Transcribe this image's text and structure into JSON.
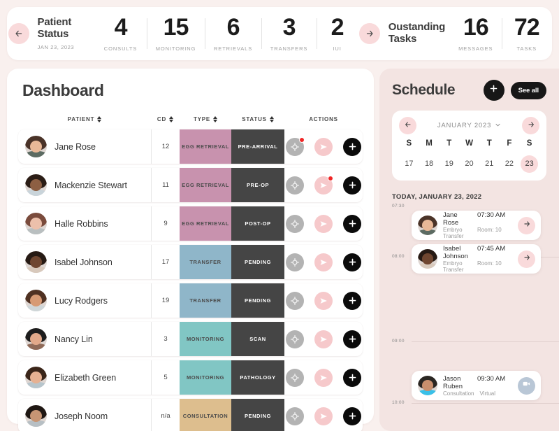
{
  "topbar": {
    "back_icon": "arrow-left-icon",
    "forward_icon": "arrow-right-icon",
    "left_title": "Patient\nStatus",
    "left_title_l1": "Patient",
    "left_title_l2": "Status",
    "left_date": "JAN 23, 2023",
    "right_title_l1": "Oustanding",
    "right_title_l2": "Tasks",
    "left_stats": [
      {
        "num": "4",
        "label": "CONSULTS"
      },
      {
        "num": "15",
        "label": "MONITORING"
      },
      {
        "num": "6",
        "label": "RETRIEVALS"
      },
      {
        "num": "3",
        "label": "TRANSFERS"
      },
      {
        "num": "2",
        "label": "IUI"
      }
    ],
    "right_stats": [
      {
        "num": "16",
        "label": "MESSAGES"
      },
      {
        "num": "72",
        "label": "TASKS"
      }
    ]
  },
  "dashboard": {
    "title": "Dashboard",
    "columns": [
      {
        "label": "PATIENT",
        "sortable": true
      },
      {
        "label": "CD",
        "sortable": true
      },
      {
        "label": "TYPE",
        "sortable": true
      },
      {
        "label": "STATUS",
        "sortable": true
      },
      {
        "label": "ACTIONS",
        "sortable": false
      }
    ],
    "action_icons": [
      "target-icon",
      "send-icon",
      "plus-icon"
    ],
    "rows": [
      {
        "name": "Jane Rose",
        "cd": "12",
        "type": "EGG RETRIEVAL",
        "type_color": "#c892ae",
        "status": "PRE-ARRIVAL",
        "badge_target": true,
        "badge_send": false,
        "avatar": {
          "hair": "#4a3328",
          "skin": "#e8b897",
          "body": "#5c6b62"
        }
      },
      {
        "name": "Mackenzie Stewart",
        "cd": "11",
        "type": "EGG RETRIEVAL",
        "type_color": "#c892ae",
        "status": "PRE-OP",
        "badge_target": false,
        "badge_send": true,
        "avatar": {
          "hair": "#2b1d16",
          "skin": "#8d5f43",
          "body": "#c9d4da"
        }
      },
      {
        "name": "Halle Robbins",
        "cd": "9",
        "type": "EGG RETRIEVAL",
        "type_color": "#c892ae",
        "status": "POST-OP",
        "badge_target": false,
        "badge_send": false,
        "avatar": {
          "hair": "#7a4b3c",
          "skin": "#ecc0ab",
          "body": "#b9bfc0"
        }
      },
      {
        "name": "Isabel Johnson",
        "cd": "17",
        "type": "TRANSFER",
        "type_color": "#8fb6c9",
        "status": "PENDING",
        "badge_target": false,
        "badge_send": false,
        "avatar": {
          "hair": "#261a14",
          "skin": "#6f4630",
          "body": "#d8c9bc"
        }
      },
      {
        "name": "Lucy Rodgers",
        "cd": "19",
        "type": "TRANSFER",
        "type_color": "#8fb6c9",
        "status": "PENDING",
        "badge_target": false,
        "badge_send": false,
        "avatar": {
          "hair": "#4f3122",
          "skin": "#d79a74",
          "body": "#cfd6d8"
        }
      },
      {
        "name": "Nancy Lin",
        "cd": "3",
        "type": "MONITORING",
        "type_color": "#81c6c4",
        "status": "SCAN",
        "badge_target": false,
        "badge_send": false,
        "avatar": {
          "hair": "#1d1d1d",
          "skin": "#e2a98a",
          "body": "#8f6a58"
        }
      },
      {
        "name": "Elizabeth Green",
        "cd": "5",
        "type": "MONITORING",
        "type_color": "#81c6c4",
        "status": "PATHOLOGY",
        "badge_target": false,
        "badge_send": false,
        "avatar": {
          "hair": "#3a2519",
          "skin": "#e6b192",
          "body": "#b7c5cc"
        }
      },
      {
        "name": "Joseph Noom",
        "cd": "n/a",
        "type": "CONSULTATION",
        "type_color": "#ddbe8e",
        "status": "PENDING",
        "badge_target": false,
        "badge_send": false,
        "avatar": {
          "hair": "#1f1713",
          "skin": "#c79574",
          "body": "#b7bfc4"
        }
      }
    ]
  },
  "schedule": {
    "title": "Schedule",
    "add_icon": "plus-icon",
    "see_all_label": "See all",
    "calendar": {
      "prev_icon": "arrow-left-icon",
      "next_icon": "arrow-right-icon",
      "month_label": "JANUARY 2023",
      "chevron_icon": "chevron-down-icon",
      "dow": [
        "S",
        "M",
        "T",
        "W",
        "T",
        "F",
        "S"
      ],
      "days": [
        "17",
        "18",
        "19",
        "20",
        "21",
        "22",
        "23"
      ],
      "selected_day": "23"
    },
    "today_label": "TODAY, JANUARY 23, 2022",
    "time_marks": [
      "07:30",
      "08:00",
      "09:00",
      "10:00"
    ],
    "appointments": [
      {
        "name": "Jane Rose",
        "subtitle": "Embryo Transfer",
        "time": "07:30 AM",
        "room": "Room: 10",
        "action_icon": "arrow-right-icon",
        "action_kind": "arrow",
        "avatar": {
          "hair": "#4a3328",
          "skin": "#e8b897",
          "body": "#5c6b62"
        }
      },
      {
        "name": "Isabel Johnson",
        "subtitle": "Embryo Transfer",
        "time": "07:45 AM",
        "room": "Room: 10",
        "action_icon": "arrow-right-icon",
        "action_kind": "arrow",
        "avatar": {
          "hair": "#261a14",
          "skin": "#6f4630",
          "body": "#d8c9bc"
        }
      },
      {
        "name": "Jason Ruben",
        "subtitle": "Consultation",
        "time": "09:30 AM",
        "room": "Virtual",
        "action_icon": "video-icon",
        "action_kind": "video",
        "avatar": {
          "hair": "#2a2622",
          "skin": "#c98f6d",
          "body": "#3ac0e8"
        }
      }
    ]
  },
  "colors": {
    "page_bg": "#f9f0ee",
    "panel_bg": "#f3e4e2",
    "pink_accent": "#f9dadb",
    "dark": "#171717",
    "status_bg": "#454545",
    "badge_red": "#f02626"
  }
}
